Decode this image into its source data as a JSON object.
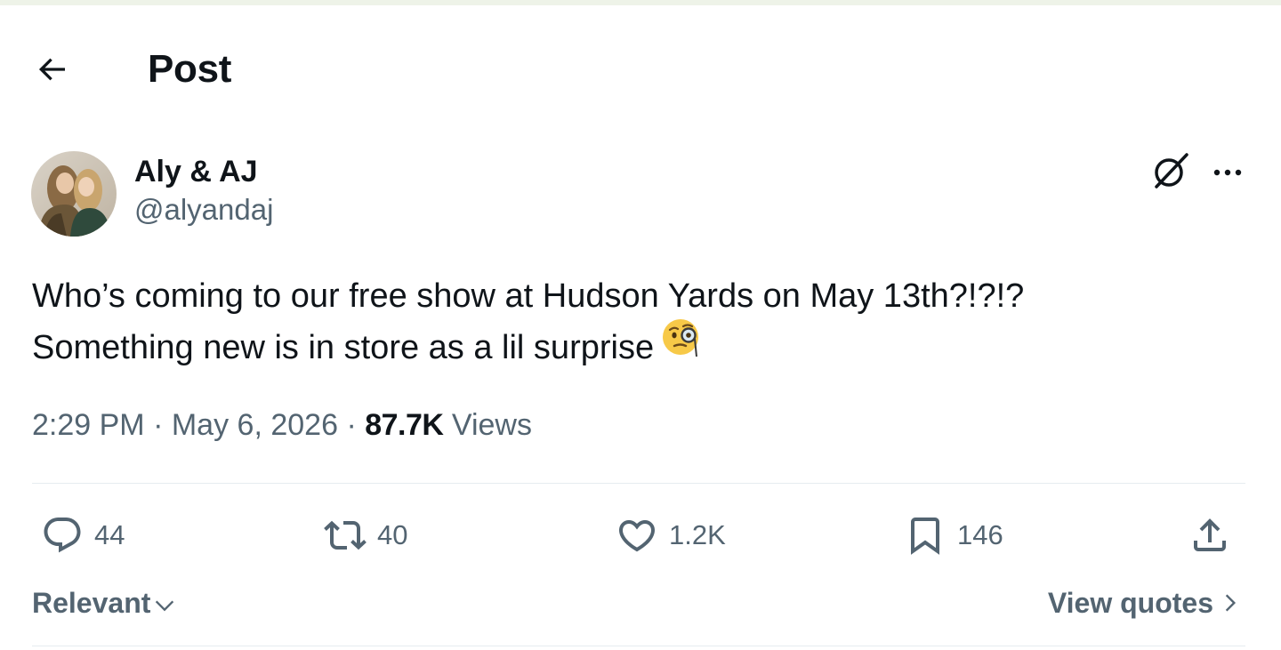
{
  "header": {
    "title": "Post"
  },
  "post": {
    "author": {
      "display_name": "Aly & AJ",
      "handle": "@alyandaj"
    },
    "text_line1": "Who’s coming to our free show at Hudson Yards on May 13th?!?!?",
    "text_line2": "Something new is in store as a lil surprise",
    "emoji_name": "face-with-monocle",
    "time": "2:29 PM",
    "date": "May 6, 2026",
    "separator": "·",
    "views_count": "87.7K",
    "views_label": "Views"
  },
  "stats": {
    "replies": "44",
    "reposts": "40",
    "likes": "1.2K",
    "bookmarks": "146"
  },
  "footer": {
    "sort_label": "Relevant",
    "view_quotes_label": "View quotes"
  },
  "colors": {
    "text_primary": "#0f1419",
    "text_secondary": "#536471",
    "divider": "#e6ecf0"
  }
}
